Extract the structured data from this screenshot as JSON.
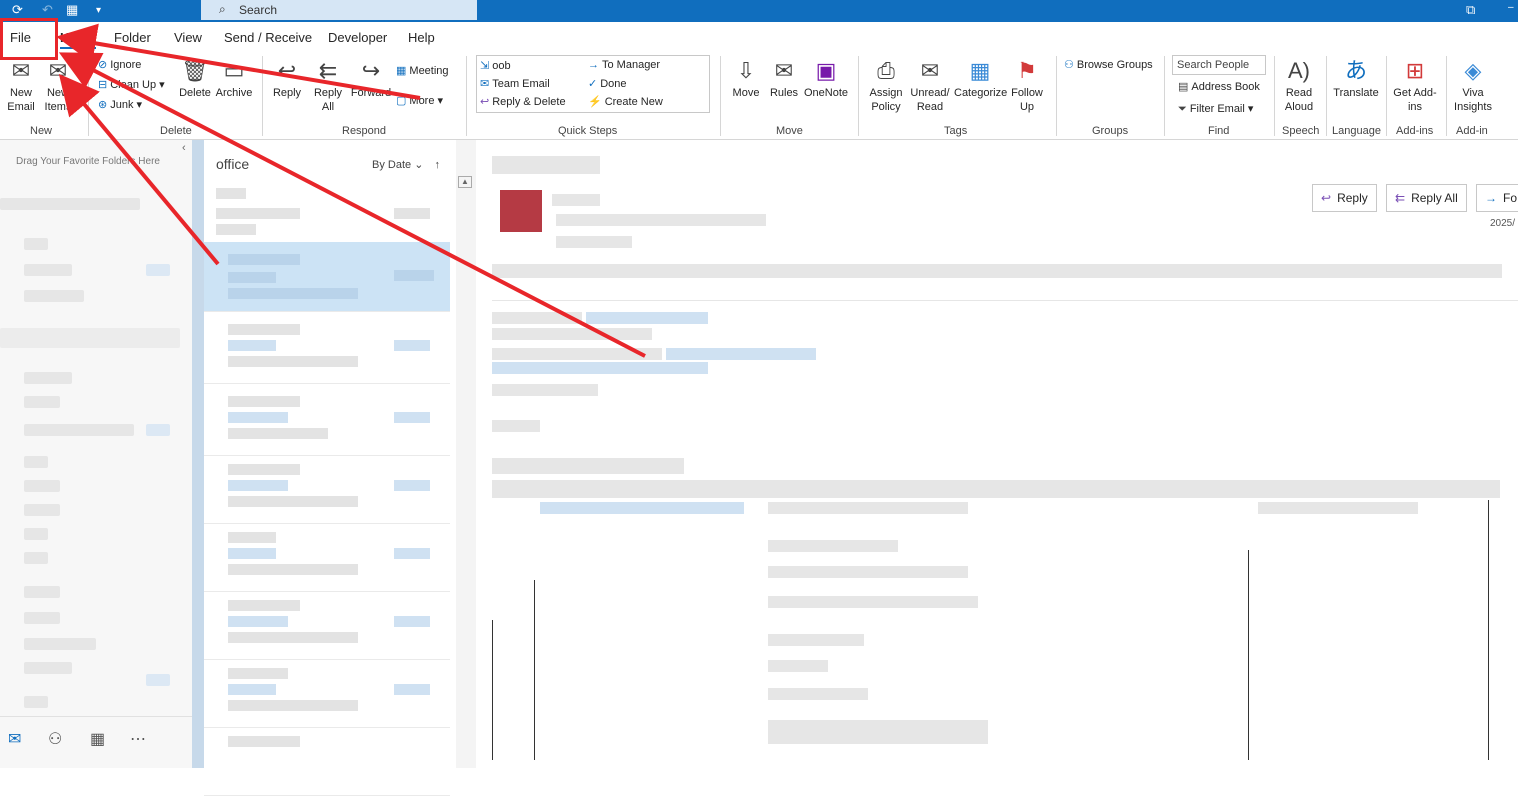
{
  "search": {
    "label": "Search"
  },
  "tabs": [
    "File",
    "Home",
    "Folder",
    "View",
    "Send / Receive",
    "Developer",
    "Help"
  ],
  "ribbon": {
    "new": {
      "new_email": "New Email",
      "new_items": "New Items",
      "group": "New"
    },
    "delete": {
      "ignore": "Ignore",
      "clean_up": "Clean Up",
      "junk": "Junk",
      "delete": "Delete",
      "archive": "Archive",
      "group": "Delete"
    },
    "respond": {
      "reply": "Reply",
      "reply_all": "Reply All",
      "forward": "Forward",
      "meeting": "Meeting",
      "more": "More",
      "group": "Respond"
    },
    "quick_steps": {
      "items": [
        "oob",
        "Team Email",
        "Reply & Delete",
        "To Manager",
        "Done",
        "Create New"
      ],
      "group": "Quick Steps"
    },
    "move": {
      "move": "Move",
      "rules": "Rules",
      "onenote": "OneNote",
      "group": "Move"
    },
    "tags": {
      "assign_policy": "Assign Policy",
      "unread_read": "Unread/ Read",
      "categorize": "Categorize",
      "follow_up": "Follow Up",
      "group": "Tags"
    },
    "groups": {
      "browse": "Browse Groups",
      "group": "Groups"
    },
    "find": {
      "search_people": "Search People",
      "address_book": "Address Book",
      "filter_email": "Filter Email",
      "group": "Find"
    },
    "speech": {
      "read_aloud": "Read Aloud",
      "group": "Speech"
    },
    "language": {
      "translate": "Translate",
      "group": "Language"
    },
    "addins": {
      "get_addins": "Get Add-ins",
      "group": "Add-ins"
    },
    "addin": {
      "viva": "Viva Insights",
      "group": "Add-in"
    }
  },
  "nav": {
    "drag_hint": "Drag Your Favorite Folders Here"
  },
  "list": {
    "folder": "office",
    "sort": "By Date"
  },
  "reader": {
    "reply": "Reply",
    "reply_all": "Reply All",
    "forward": "Fo",
    "date": "2025/"
  },
  "colors": {
    "accent": "#106ebe",
    "annotation": "#e8262a"
  }
}
